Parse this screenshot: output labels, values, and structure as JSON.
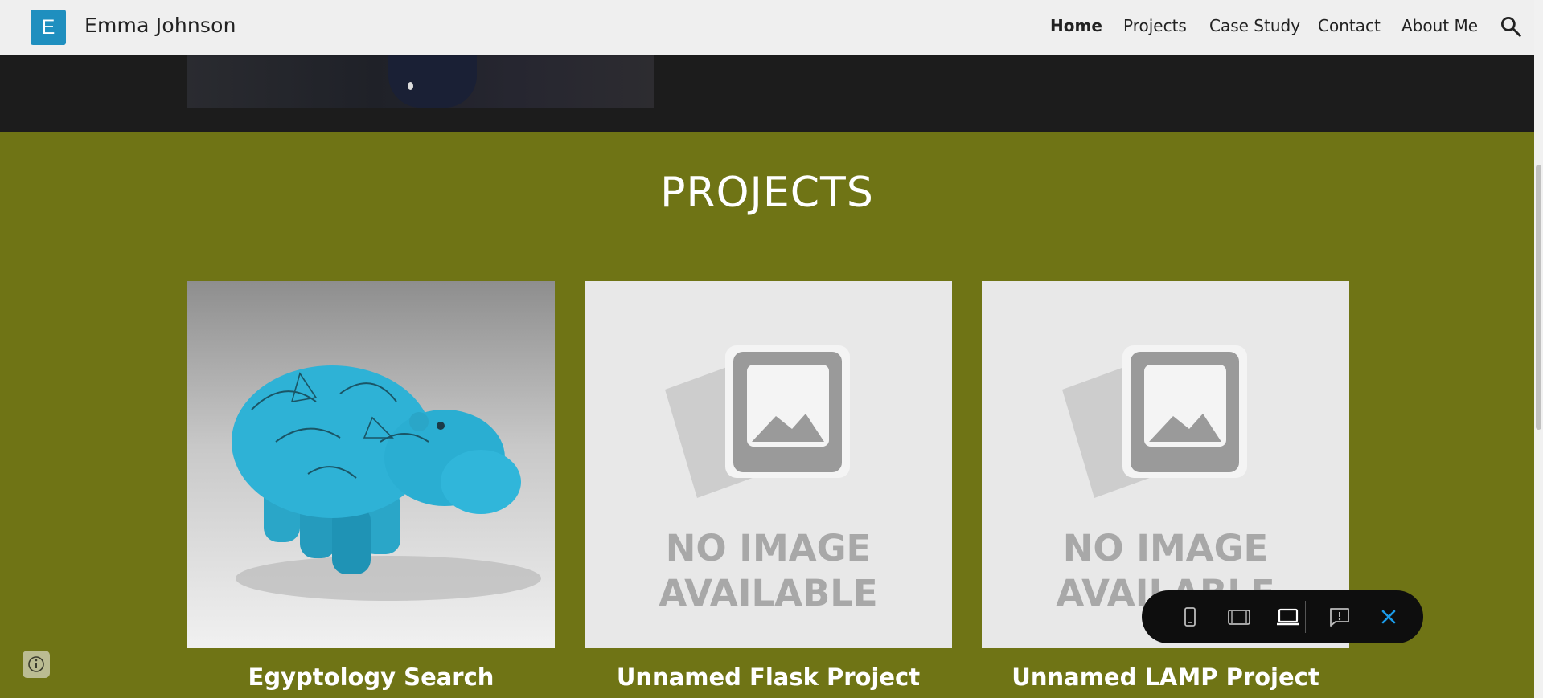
{
  "header": {
    "logo_letter": "E",
    "site_title": "Emma Johnson",
    "nav": [
      {
        "label": "Home",
        "active": true
      },
      {
        "label": "Projects",
        "active": false
      },
      {
        "label": "Case Study",
        "active": false
      },
      {
        "label": "Contact",
        "active": false
      },
      {
        "label": "About Me",
        "active": false
      }
    ],
    "search_icon": "search-icon"
  },
  "section": {
    "title": "PROJECTS",
    "cards": [
      {
        "title": "Egyptology Search",
        "image": "blue hippo figurine"
      },
      {
        "title": "Unnamed Flask Project",
        "image_text_1": "NO IMAGE",
        "image_text_2": "AVAILABLE"
      },
      {
        "title": "Unnamed LAMP Project",
        "image_text_1": "NO IMAGE",
        "image_text_2": "AVAILABLE"
      }
    ]
  },
  "toolbar": {
    "icons": [
      "phone-view-icon",
      "tablet-view-icon",
      "laptop-view-icon",
      "feedback-icon",
      "close-icon"
    ]
  },
  "colors": {
    "section_bg": "#6f7415",
    "header_bg": "#efefef",
    "logo_bg": "#1f8fbf",
    "dark_band": "#1c1c1c",
    "toolbar_bg": "#0e0e0e",
    "close_accent": "#1a9bea"
  }
}
